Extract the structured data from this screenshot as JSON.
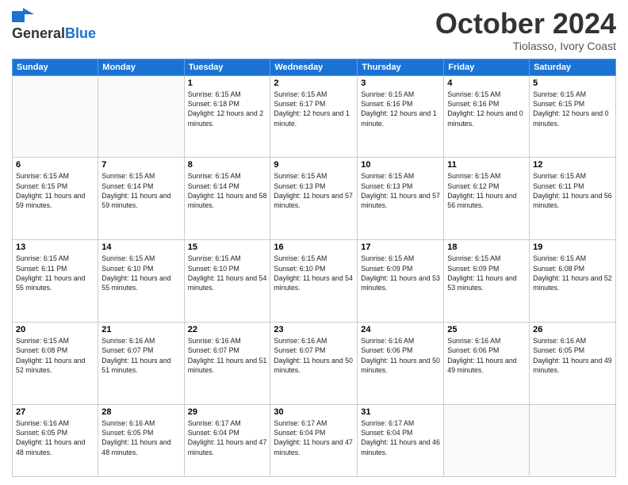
{
  "header": {
    "logo_general": "General",
    "logo_blue": "Blue",
    "month_title": "October 2024",
    "subtitle": "Tiolasso, Ivory Coast"
  },
  "days_of_week": [
    "Sunday",
    "Monday",
    "Tuesday",
    "Wednesday",
    "Thursday",
    "Friday",
    "Saturday"
  ],
  "weeks": [
    [
      {
        "day": "",
        "sunrise": "",
        "sunset": "",
        "daylight": ""
      },
      {
        "day": "",
        "sunrise": "",
        "sunset": "",
        "daylight": ""
      },
      {
        "day": "1",
        "sunrise": "Sunrise: 6:15 AM",
        "sunset": "Sunset: 6:18 PM",
        "daylight": "Daylight: 12 hours and 2 minutes."
      },
      {
        "day": "2",
        "sunrise": "Sunrise: 6:15 AM",
        "sunset": "Sunset: 6:17 PM",
        "daylight": "Daylight: 12 hours and 1 minute."
      },
      {
        "day": "3",
        "sunrise": "Sunrise: 6:15 AM",
        "sunset": "Sunset: 6:16 PM",
        "daylight": "Daylight: 12 hours and 1 minute."
      },
      {
        "day": "4",
        "sunrise": "Sunrise: 6:15 AM",
        "sunset": "Sunset: 6:16 PM",
        "daylight": "Daylight: 12 hours and 0 minutes."
      },
      {
        "day": "5",
        "sunrise": "Sunrise: 6:15 AM",
        "sunset": "Sunset: 6:15 PM",
        "daylight": "Daylight: 12 hours and 0 minutes."
      }
    ],
    [
      {
        "day": "6",
        "sunrise": "Sunrise: 6:15 AM",
        "sunset": "Sunset: 6:15 PM",
        "daylight": "Daylight: 11 hours and 59 minutes."
      },
      {
        "day": "7",
        "sunrise": "Sunrise: 6:15 AM",
        "sunset": "Sunset: 6:14 PM",
        "daylight": "Daylight: 11 hours and 59 minutes."
      },
      {
        "day": "8",
        "sunrise": "Sunrise: 6:15 AM",
        "sunset": "Sunset: 6:14 PM",
        "daylight": "Daylight: 11 hours and 58 minutes."
      },
      {
        "day": "9",
        "sunrise": "Sunrise: 6:15 AM",
        "sunset": "Sunset: 6:13 PM",
        "daylight": "Daylight: 11 hours and 57 minutes."
      },
      {
        "day": "10",
        "sunrise": "Sunrise: 6:15 AM",
        "sunset": "Sunset: 6:13 PM",
        "daylight": "Daylight: 11 hours and 57 minutes."
      },
      {
        "day": "11",
        "sunrise": "Sunrise: 6:15 AM",
        "sunset": "Sunset: 6:12 PM",
        "daylight": "Daylight: 11 hours and 56 minutes."
      },
      {
        "day": "12",
        "sunrise": "Sunrise: 6:15 AM",
        "sunset": "Sunset: 6:11 PM",
        "daylight": "Daylight: 11 hours and 56 minutes."
      }
    ],
    [
      {
        "day": "13",
        "sunrise": "Sunrise: 6:15 AM",
        "sunset": "Sunset: 6:11 PM",
        "daylight": "Daylight: 11 hours and 55 minutes."
      },
      {
        "day": "14",
        "sunrise": "Sunrise: 6:15 AM",
        "sunset": "Sunset: 6:10 PM",
        "daylight": "Daylight: 11 hours and 55 minutes."
      },
      {
        "day": "15",
        "sunrise": "Sunrise: 6:15 AM",
        "sunset": "Sunset: 6:10 PM",
        "daylight": "Daylight: 11 hours and 54 minutes."
      },
      {
        "day": "16",
        "sunrise": "Sunrise: 6:15 AM",
        "sunset": "Sunset: 6:10 PM",
        "daylight": "Daylight: 11 hours and 54 minutes."
      },
      {
        "day": "17",
        "sunrise": "Sunrise: 6:15 AM",
        "sunset": "Sunset: 6:09 PM",
        "daylight": "Daylight: 11 hours and 53 minutes."
      },
      {
        "day": "18",
        "sunrise": "Sunrise: 6:15 AM",
        "sunset": "Sunset: 6:09 PM",
        "daylight": "Daylight: 11 hours and 53 minutes."
      },
      {
        "day": "19",
        "sunrise": "Sunrise: 6:15 AM",
        "sunset": "Sunset: 6:08 PM",
        "daylight": "Daylight: 11 hours and 52 minutes."
      }
    ],
    [
      {
        "day": "20",
        "sunrise": "Sunrise: 6:15 AM",
        "sunset": "Sunset: 6:08 PM",
        "daylight": "Daylight: 11 hours and 52 minutes."
      },
      {
        "day": "21",
        "sunrise": "Sunrise: 6:16 AM",
        "sunset": "Sunset: 6:07 PM",
        "daylight": "Daylight: 11 hours and 51 minutes."
      },
      {
        "day": "22",
        "sunrise": "Sunrise: 6:16 AM",
        "sunset": "Sunset: 6:07 PM",
        "daylight": "Daylight: 11 hours and 51 minutes."
      },
      {
        "day": "23",
        "sunrise": "Sunrise: 6:16 AM",
        "sunset": "Sunset: 6:07 PM",
        "daylight": "Daylight: 11 hours and 50 minutes."
      },
      {
        "day": "24",
        "sunrise": "Sunrise: 6:16 AM",
        "sunset": "Sunset: 6:06 PM",
        "daylight": "Daylight: 11 hours and 50 minutes."
      },
      {
        "day": "25",
        "sunrise": "Sunrise: 6:16 AM",
        "sunset": "Sunset: 6:06 PM",
        "daylight": "Daylight: 11 hours and 49 minutes."
      },
      {
        "day": "26",
        "sunrise": "Sunrise: 6:16 AM",
        "sunset": "Sunset: 6:05 PM",
        "daylight": "Daylight: 11 hours and 49 minutes."
      }
    ],
    [
      {
        "day": "27",
        "sunrise": "Sunrise: 6:16 AM",
        "sunset": "Sunset: 6:05 PM",
        "daylight": "Daylight: 11 hours and 48 minutes."
      },
      {
        "day": "28",
        "sunrise": "Sunrise: 6:16 AM",
        "sunset": "Sunset: 6:05 PM",
        "daylight": "Daylight: 11 hours and 48 minutes."
      },
      {
        "day": "29",
        "sunrise": "Sunrise: 6:17 AM",
        "sunset": "Sunset: 6:04 PM",
        "daylight": "Daylight: 11 hours and 47 minutes."
      },
      {
        "day": "30",
        "sunrise": "Sunrise: 6:17 AM",
        "sunset": "Sunset: 6:04 PM",
        "daylight": "Daylight: 11 hours and 47 minutes."
      },
      {
        "day": "31",
        "sunrise": "Sunrise: 6:17 AM",
        "sunset": "Sunset: 6:04 PM",
        "daylight": "Daylight: 11 hours and 46 minutes."
      },
      {
        "day": "",
        "sunrise": "",
        "sunset": "",
        "daylight": ""
      },
      {
        "day": "",
        "sunrise": "",
        "sunset": "",
        "daylight": ""
      }
    ]
  ]
}
